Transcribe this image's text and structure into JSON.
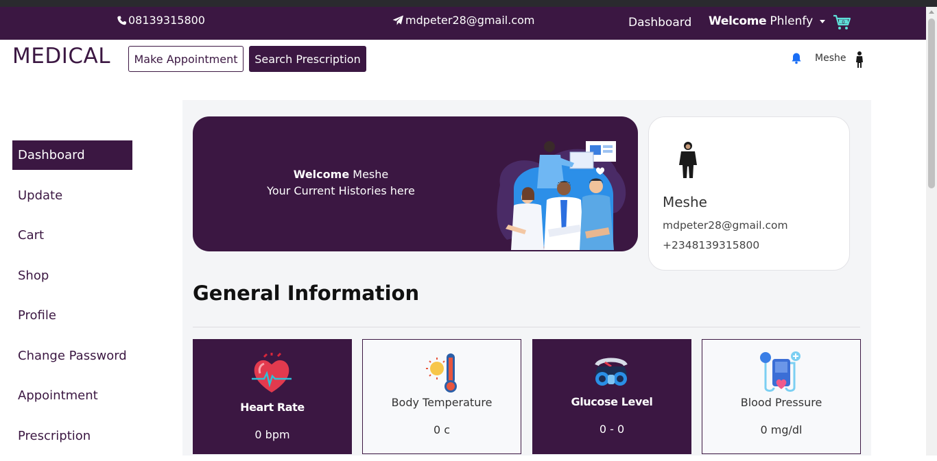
{
  "topbar": {
    "phone": "08139315800",
    "email": "mdpeter28@gmail.com",
    "nav_dashboard": "Dashboard",
    "welcome_bold": "Welcome",
    "welcome_name": "Phlenfy",
    "cart_icon": "cart-icon"
  },
  "header": {
    "brand": "MEDICAL",
    "make_appointment": "Make Appointment",
    "search_prescription": "Search Prescription",
    "user_name": "Meshe",
    "bell_icon": "bell-icon"
  },
  "sidebar": {
    "items": [
      {
        "label": "Dashboard",
        "active": true
      },
      {
        "label": "Update"
      },
      {
        "label": "Cart"
      },
      {
        "label": "Shop"
      },
      {
        "label": "Profile"
      },
      {
        "label": "Change Password"
      },
      {
        "label": "Appointment"
      },
      {
        "label": "Prescription"
      }
    ]
  },
  "banner": {
    "welcome_bold": "Welcome",
    "welcome_name": "Meshe",
    "subtitle": "Your Current Histories here"
  },
  "profile": {
    "name": "Meshe",
    "email": "mdpeter28@gmail.com",
    "phone": "+2348139315800"
  },
  "main": {
    "section_title": "General Information",
    "stats": [
      {
        "label": "Heart Rate",
        "value": "0 bpm",
        "icon": "heart-icon",
        "style": "dark"
      },
      {
        "label": "Body Temperature",
        "value": "0 c",
        "icon": "thermometer-icon",
        "style": "light"
      },
      {
        "label": "Glucose Level",
        "value": "0 - 0",
        "icon": "glucose-meter-icon",
        "style": "dark"
      },
      {
        "label": "Blood Pressure",
        "value": "0 mg/dl",
        "icon": "blood-pressure-icon",
        "style": "light"
      }
    ]
  },
  "colors": {
    "brand_purple": "#3b1742",
    "content_bg": "#f4f5f7",
    "bell_blue": "#1a6ef5"
  }
}
